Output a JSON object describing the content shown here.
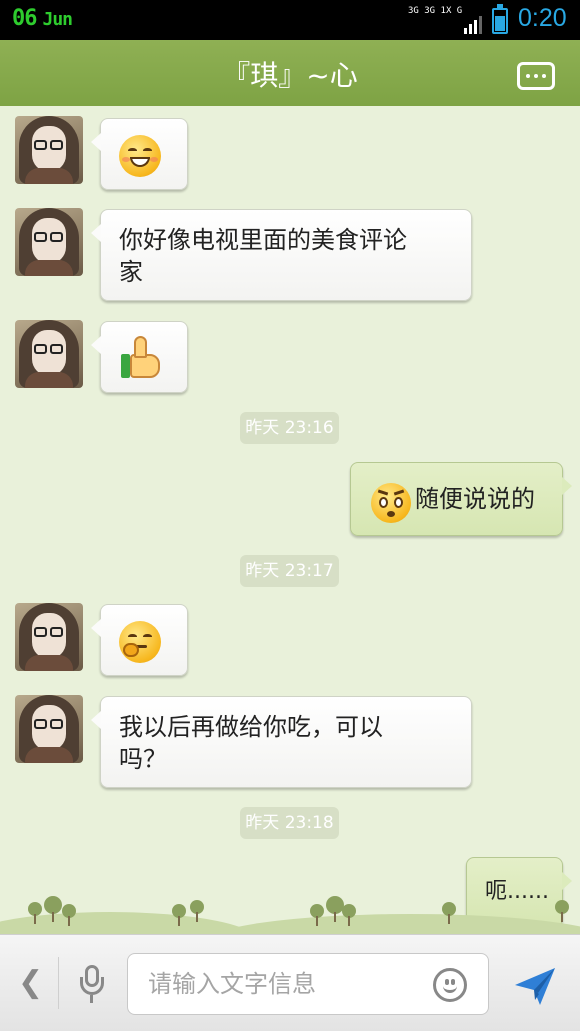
{
  "status_bar": {
    "day": "06",
    "month": "Jun",
    "network_labels": [
      "3G",
      "3G",
      "1X",
      "G"
    ],
    "time": "0:20",
    "battery_level": 0.7,
    "signal_bars": 3
  },
  "header": {
    "title": "『琪』~心",
    "menu_icon": "more-dots-icon"
  },
  "messages": [
    {
      "side": "left",
      "type": "emoji",
      "emoji": "smile-emoji"
    },
    {
      "side": "left",
      "type": "text",
      "lines": [
        "你好像电视里面的美食评论",
        "家"
      ]
    },
    {
      "side": "left",
      "type": "emoji",
      "emoji": "thumbs-up-emoji"
    },
    {
      "type": "timestamp",
      "text": "昨天 23:16"
    },
    {
      "side": "right",
      "type": "text",
      "emoji": "confused-emoji",
      "text": "随便说说的"
    },
    {
      "type": "timestamp",
      "text": "昨天 23:17"
    },
    {
      "side": "left",
      "type": "emoji",
      "emoji": "thinking-emoji"
    },
    {
      "side": "left",
      "type": "text",
      "lines": [
        "我以后再做给你吃，可以",
        "吗？"
      ]
    },
    {
      "type": "timestamp",
      "text": "昨天 23:18"
    },
    {
      "side": "right",
      "type": "text",
      "text": "呃......"
    }
  ],
  "input_bar": {
    "back_icon": "chevron-left-icon",
    "mic_icon": "microphone-icon",
    "placeholder": "请输入文字信息",
    "emoji_icon": "smiley-icon",
    "send_icon": "send-icon"
  },
  "colors": {
    "header": "#7ea344",
    "chat_background": "#e9f1da",
    "outgoing_bubble": "#d6e6b2",
    "incoming_bubble": "#ffffff",
    "timestamp_badge": "#d7dfc6",
    "status_time": "#29a8e3",
    "status_date": "#2ecc2e"
  }
}
